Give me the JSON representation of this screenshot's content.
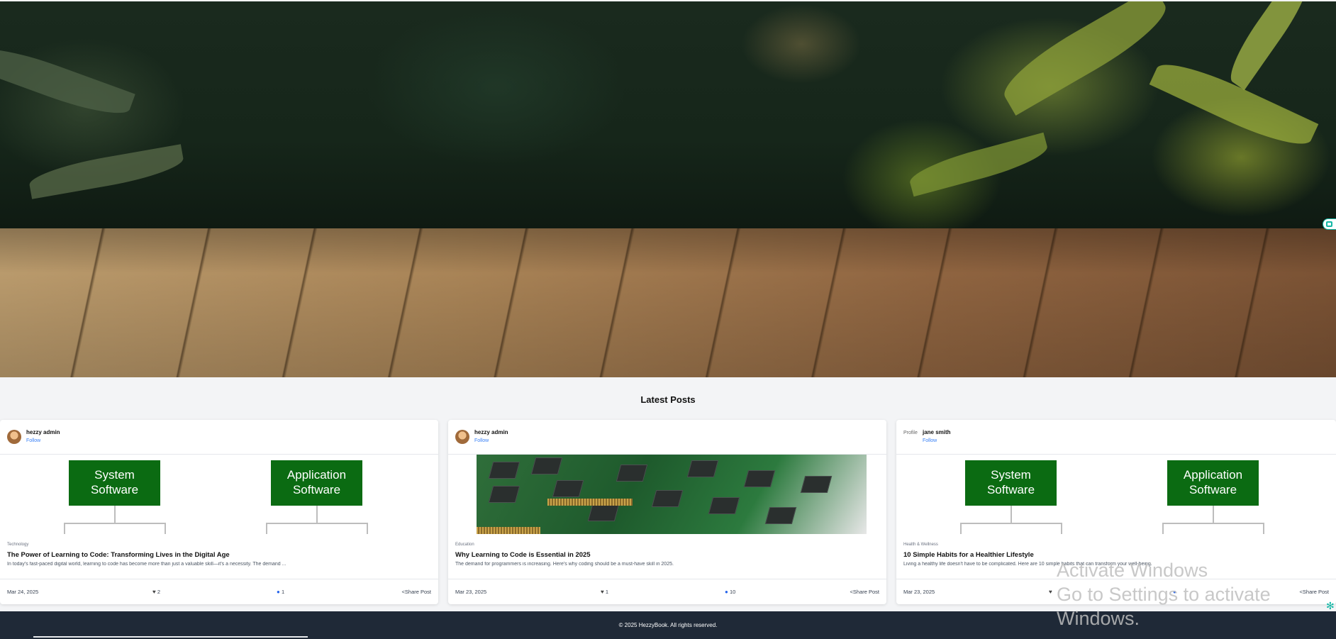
{
  "section": {
    "title": "Latest Posts"
  },
  "posts": [
    {
      "author": "hezzy admin",
      "follow_label": "Follow",
      "category": "Technology",
      "title": "The Power of Learning to Code: Transforming Lives in the Digital Age",
      "excerpt": "In today's fast-paced digital world, learning to code has become more than just a valuable skill—it's a necessity. The demand ...",
      "date": "Mar 24, 2025",
      "likes": "2",
      "comments": "1",
      "share_label": "Share Post",
      "image": {
        "type": "diagram",
        "left_box": [
          "System",
          "Software"
        ],
        "right_box": [
          "Application",
          "Software"
        ]
      }
    },
    {
      "author": "hezzy admin",
      "follow_label": "Follow",
      "category": "Education",
      "title": "Why Learning to Code is Essential in 2025",
      "excerpt": "The demand for programmers is increasing. Here's why coding should be a must-have skill in 2025.",
      "date": "Mar 23, 2025",
      "likes": "1",
      "comments": "10",
      "share_label": "Share Post",
      "image": {
        "type": "photo-ram"
      }
    },
    {
      "author": "jane smith",
      "follow_label": "Follow",
      "avatar_alt": "Profile",
      "category": "Health & Wellness",
      "title": "10 Simple Habits for a Healthier Lifestyle",
      "excerpt": "Living a healthy life doesn't have to be complicated. Here are 10 simple habits that can transform your well-being.",
      "date": "Mar 23, 2025",
      "likes": "",
      "comments": "",
      "share_label": "Share Post",
      "image": {
        "type": "diagram",
        "left_box": [
          "System",
          "Software"
        ],
        "right_box": [
          "Application",
          "Software"
        ]
      }
    }
  ],
  "footer": {
    "text": "© 2025 HezzyBook. All rights reserved."
  },
  "overlay": {
    "watermark_line1": "Activate Windows",
    "watermark_line2": "Go to Settings to activate Windows."
  },
  "colors": {
    "accent": "#3b82f6",
    "diagram_green": "#0b6b12",
    "footer_bg": "#1f2937"
  }
}
